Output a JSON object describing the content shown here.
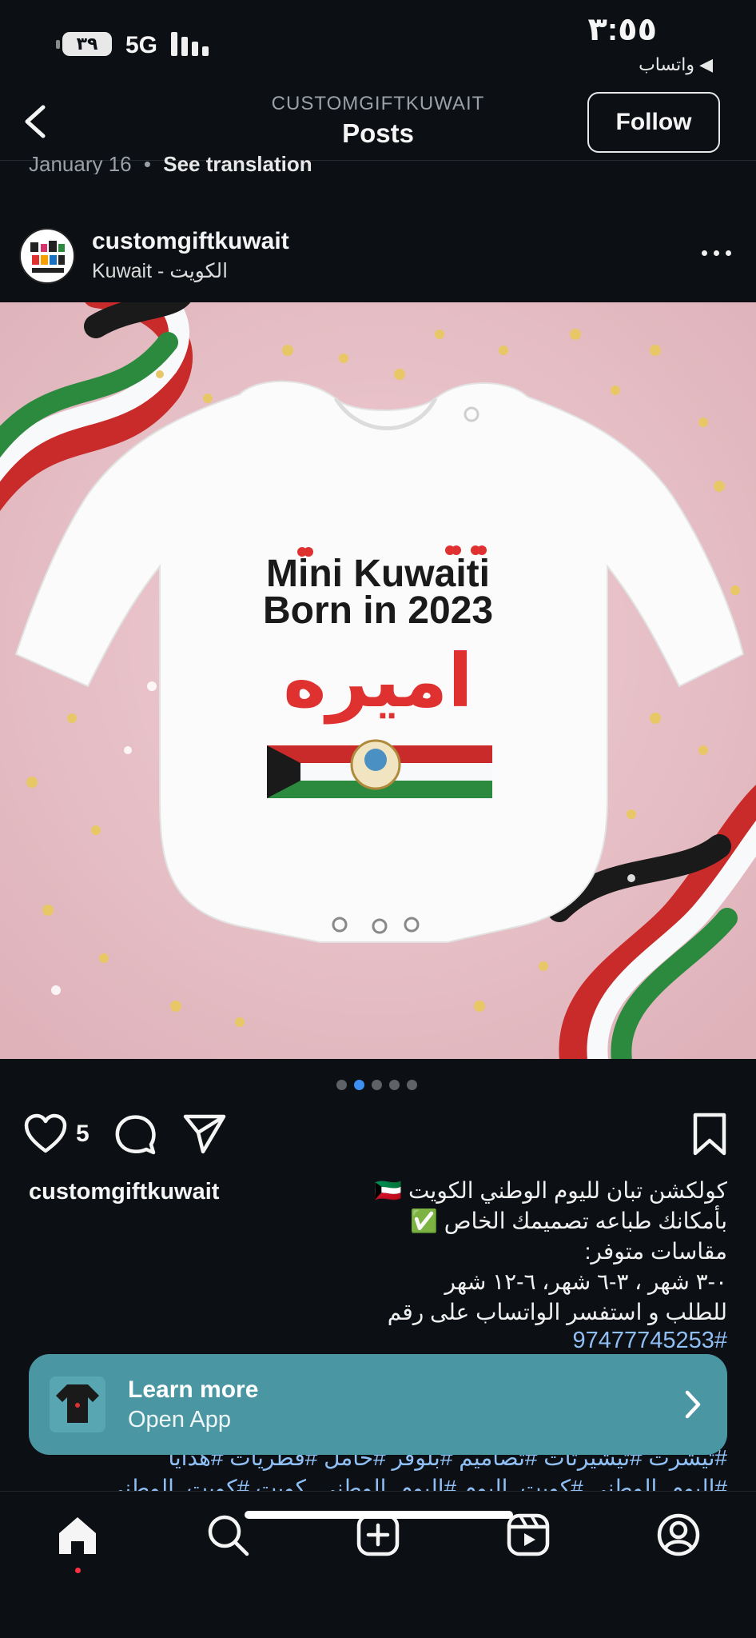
{
  "status_bar": {
    "time": "٣:٥٥",
    "back_to_app": "◀ واتساب",
    "battery": "٣٩",
    "network": "5G"
  },
  "header": {
    "account": "CUSTOMGIFTKUWAIT",
    "title": "Posts",
    "follow_label": "Follow"
  },
  "previous_post": {
    "date": "January 16",
    "separator": "•",
    "translation": "See translation"
  },
  "post": {
    "username": "customgiftkuwait",
    "location": "Kuwait - الكويت",
    "image": {
      "line1": "Mini Kuwaiti",
      "line2": "Born in 2023",
      "name_arabic": "اميره"
    },
    "carousel": {
      "count": 5,
      "active_index": 1
    },
    "likes": "5",
    "caption_user": "customgiftkuwait",
    "caption_lines": [
      "كولكشن تبان لليوم الوطني الكويت 🇰🇼",
      "بأمكانك طباعه تصميمك الخاص ✅",
      "مقاسات متوفر:",
      "٠-٣ شهر ، ٣-٦ شهر، ٦-١٢ شهر",
      "للطلب و استفسر الواتساب على رقم"
    ],
    "phone": "97477745253#",
    "hashtags_line1": "#تيشرت #تيشيرتات #تصاميم #بلوفر #حامل #فطريات #هدايا",
    "hashtags_line2": "#اليوم_الوطني #كويت_اليوم #اليوم_الوطني_كويت #كويت_الوطني"
  },
  "banner": {
    "title": "Learn more",
    "subtitle": "Open App"
  },
  "colors": {
    "background": "#0c1015",
    "banner": "#4a97a3",
    "link": "#8fbff5",
    "active_dot": "#3d8ff2",
    "notification_dot": "#ff3040"
  },
  "icons": {
    "back": "chevron-left-icon",
    "more": "more-horizontal-icon",
    "like": "heart-icon",
    "comment": "comment-icon",
    "share": "send-icon",
    "save": "bookmark-icon",
    "banner_next": "chevron-right-icon",
    "nav": [
      "home-icon",
      "search-icon",
      "create-icon",
      "reels-icon",
      "profile-icon"
    ]
  }
}
